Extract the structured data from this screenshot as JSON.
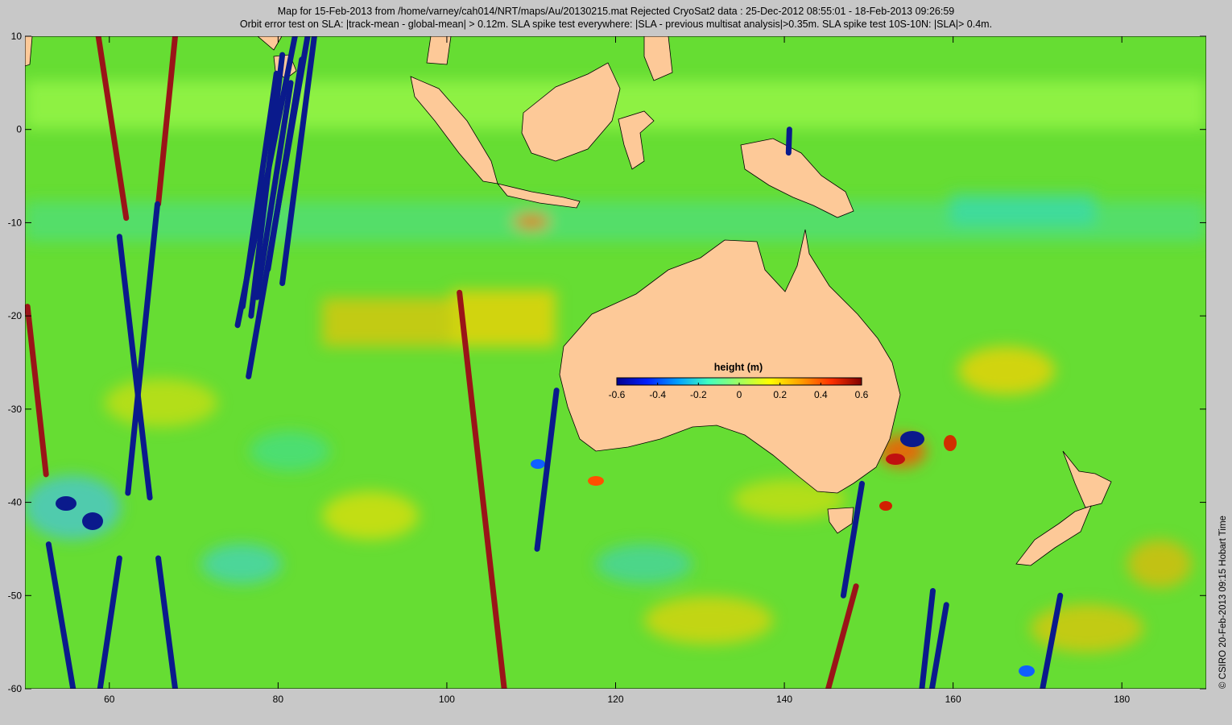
{
  "title_line1": "Map for 15-Feb-2013 from /home/varney/cah014/NRT/maps/Au/20130215.mat  Rejected CryoSat2 data : 25-Dec-2012 08:55:01 - 18-Feb-2013 09:26:59",
  "title_line2": "Orbit error test on SLA: |track-mean  - global-mean| > 0.12m.  SLA spike test everywhere: |SLA - previous multisat analysis|>0.35m. SLA spike test 10S-10N: |SLA|> 0.4m.",
  "credit": "© CSIRO 20-Feb-2013 09:15 Hobart Time",
  "map": {
    "lon_range": [
      50,
      190
    ],
    "lat_range": [
      -60,
      10
    ],
    "x_ticks": [
      {
        "value": 60,
        "label": "60"
      },
      {
        "value": 80,
        "label": "80"
      },
      {
        "value": 100,
        "label": "100"
      },
      {
        "value": 120,
        "label": "120"
      },
      {
        "value": 140,
        "label": "140"
      },
      {
        "value": 160,
        "label": "160"
      },
      {
        "value": 180,
        "label": "180"
      }
    ],
    "y_ticks": [
      {
        "value": 10,
        "label": "10"
      },
      {
        "value": 0,
        "label": "0"
      },
      {
        "value": -10,
        "label": "-10"
      },
      {
        "value": -20,
        "label": "-20"
      },
      {
        "value": -30,
        "label": "-30"
      },
      {
        "value": -40,
        "label": "-40"
      },
      {
        "value": -50,
        "label": "-50"
      },
      {
        "value": -60,
        "label": "-60"
      }
    ]
  },
  "colorbar": {
    "label": "height (m)",
    "range": [
      -0.6,
      0.6
    ],
    "ticks": [
      {
        "value": -0.6,
        "label": "-0.6"
      },
      {
        "value": -0.4,
        "label": "-0.4"
      },
      {
        "value": -0.2,
        "label": "-0.2"
      },
      {
        "value": 0,
        "label": "0"
      },
      {
        "value": 0.2,
        "label": "0.2"
      },
      {
        "value": 0.4,
        "label": "0.4"
      },
      {
        "value": 0.6,
        "label": "0.6"
      }
    ],
    "colors": [
      "#00008f",
      "#0020ff",
      "#00a0ff",
      "#40ffc0",
      "#a0ff60",
      "#ffff00",
      "#ffa000",
      "#ff3000",
      "#800000"
    ]
  },
  "colors": {
    "ocean": "#66dd33",
    "land": "#fdc998",
    "track_low": "#0a1a8c",
    "track_high": "#9a1418",
    "background": "#c8c8c8"
  },
  "tracks": [
    {
      "lon": [
        50.3,
        52.5
      ],
      "lat": [
        -19,
        -37
      ],
      "level": "high"
    },
    {
      "lon": [
        58.7,
        62.0
      ],
      "lat": [
        10,
        -9.5
      ],
      "level": "high"
    },
    {
      "lon": [
        67.8,
        65.8
      ],
      "lat": [
        10,
        -8
      ],
      "level": "high"
    },
    {
      "lon": [
        101.5,
        106.8
      ],
      "lat": [
        -17.5,
        -60
      ],
      "level": "high"
    },
    {
      "lon": [
        148.5,
        145.2
      ],
      "lat": [
        -49,
        -60
      ],
      "level": "high"
    },
    {
      "lon": [
        61.2,
        64.8
      ],
      "lat": [
        -11.5,
        -39.5
      ],
      "level": "low"
    },
    {
      "lon": [
        65.7,
        62.2
      ],
      "lat": [
        -8,
        -39
      ],
      "level": "low"
    },
    {
      "lon": [
        52.8,
        55.7
      ],
      "lat": [
        -44.5,
        -60
      ],
      "level": "low"
    },
    {
      "lon": [
        61.2,
        58.9
      ],
      "lat": [
        -46,
        -60
      ],
      "level": "low"
    },
    {
      "lon": [
        65.8,
        67.8
      ],
      "lat": [
        -46,
        -60
      ],
      "level": "low"
    },
    {
      "lon": [
        113.0,
        110.7
      ],
      "lat": [
        -28,
        -45
      ],
      "level": "low"
    },
    {
      "lon": [
        149.2,
        147.0
      ],
      "lat": [
        -38,
        -50
      ],
      "level": "low"
    },
    {
      "lon": [
        140.6,
        140.5
      ],
      "lat": [
        0,
        -2.5
      ],
      "level": "low"
    },
    {
      "lon": [
        157.6,
        156.3
      ],
      "lat": [
        -49.5,
        -60
      ],
      "level": "low"
    },
    {
      "lon": [
        159.2,
        157.5
      ],
      "lat": [
        -51,
        -60
      ],
      "level": "low"
    },
    {
      "lon": [
        172.7,
        170.6
      ],
      "lat": [
        -50,
        -60
      ],
      "level": "low"
    },
    {
      "lon": [
        82.0,
        75.2
      ],
      "lat": [
        10,
        -21
      ],
      "level": "low"
    },
    {
      "lon": [
        83.5,
        76.5
      ],
      "lat": [
        10,
        -26.5
      ],
      "level": "low"
    },
    {
      "lon": [
        79.8,
        75.8
      ],
      "lat": [
        6,
        -19
      ],
      "level": "low"
    },
    {
      "lon": [
        84.3,
        80.5
      ],
      "lat": [
        10,
        -16.5
      ],
      "level": "low"
    },
    {
      "lon": [
        82.8,
        78.8
      ],
      "lat": [
        7.5,
        -15
      ],
      "level": "low"
    },
    {
      "lon": [
        81.5,
        77.5
      ],
      "lat": [
        5,
        -18
      ],
      "level": "low"
    },
    {
      "lon": [
        80.5,
        76.8
      ],
      "lat": [
        8,
        -20
      ],
      "level": "low"
    }
  ]
}
